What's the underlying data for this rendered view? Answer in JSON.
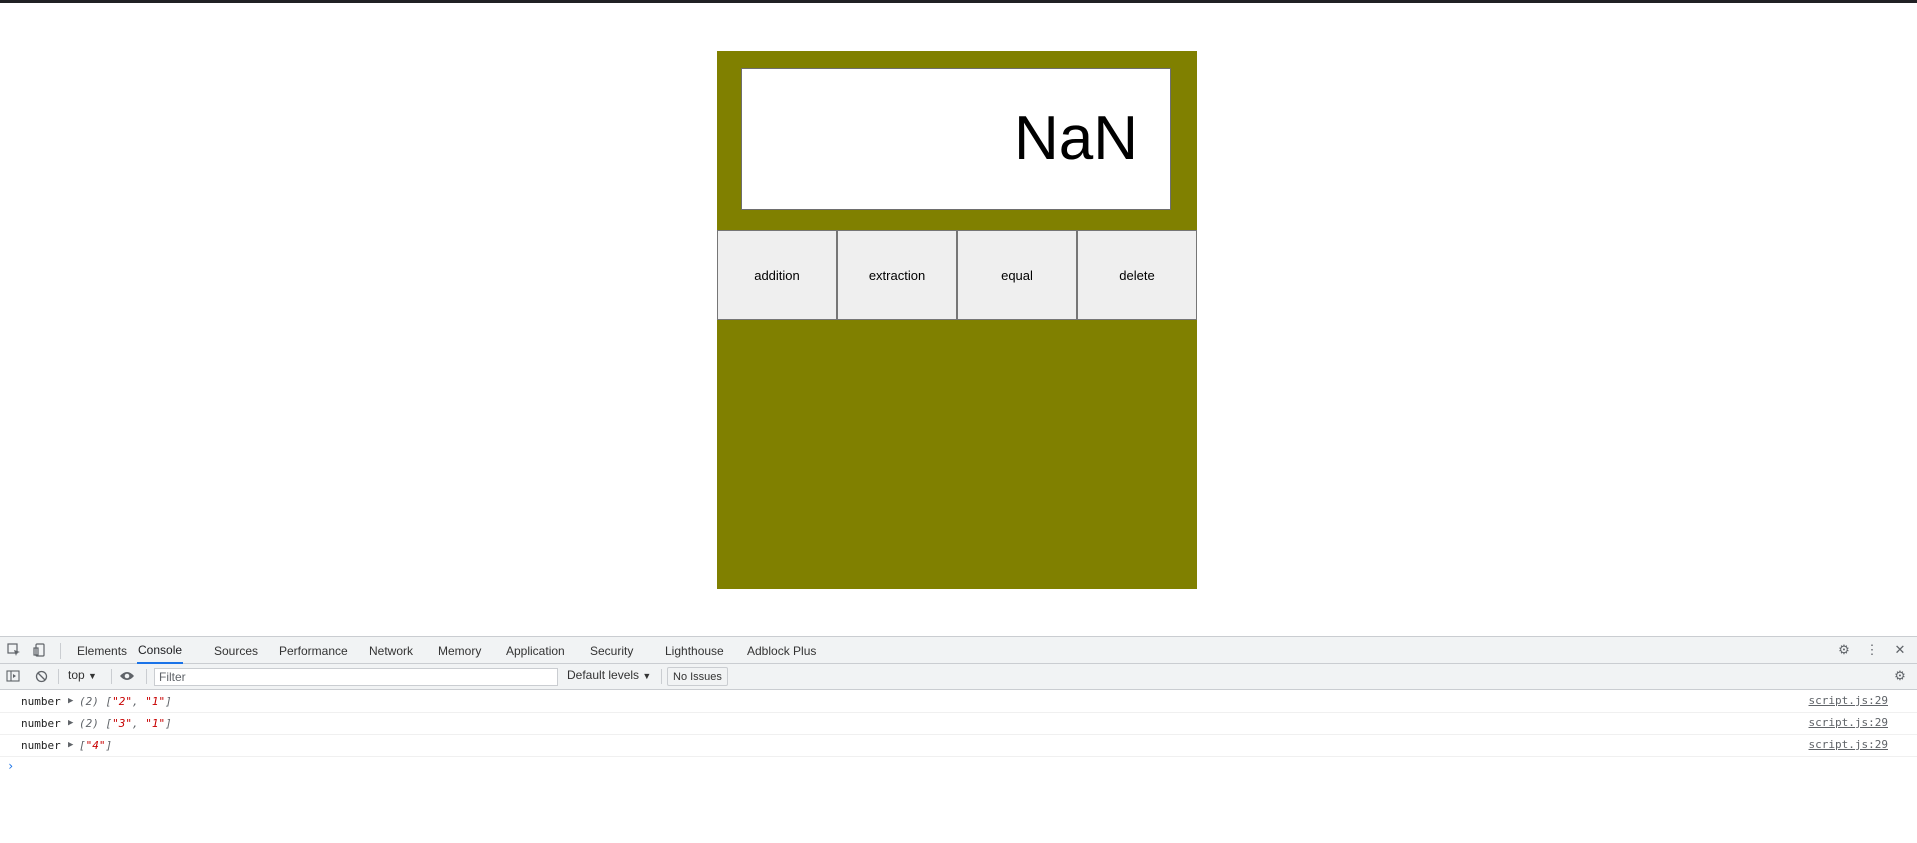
{
  "calculator": {
    "display_value": "NaN",
    "buttons": [
      "addition",
      "extraction",
      "equal",
      "delete"
    ],
    "colors": {
      "body": "#808000",
      "display_bg": "#ffffff",
      "button_bg": "#efefef"
    }
  },
  "devtools": {
    "tabs": [
      "Elements",
      "Console",
      "Sources",
      "Performance",
      "Network",
      "Memory",
      "Application",
      "Security",
      "Lighthouse",
      "Adblock Plus"
    ],
    "active_tab": "Console",
    "toolbar": {
      "context": "top",
      "filter_placeholder": "Filter",
      "levels": "Default levels",
      "issues": "No Issues"
    },
    "console_rows": [
      {
        "label": "number",
        "count": "(2)",
        "values": [
          "\"2\"",
          "\"1\""
        ],
        "source": "script.js:29"
      },
      {
        "label": "number",
        "count": "(2)",
        "values": [
          "\"3\"",
          "\"1\""
        ],
        "source": "script.js:29"
      },
      {
        "label": "number",
        "count": "",
        "values": [
          "\"4\""
        ],
        "source": "script.js:29"
      }
    ],
    "prompt": "›",
    "icons": [
      "inspect-icon",
      "device-toggle-icon",
      "sidebar-toggle-icon",
      "clear-console-icon",
      "eye-icon",
      "settings-icon",
      "more-options-icon",
      "close-icon"
    ]
  }
}
